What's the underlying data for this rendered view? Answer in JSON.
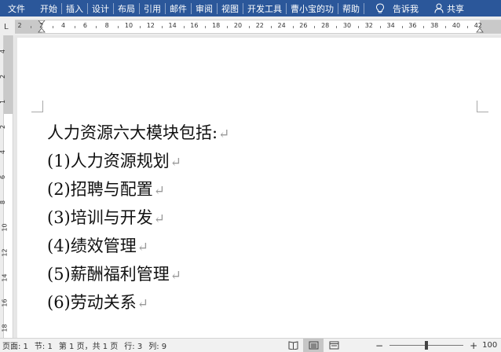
{
  "ribbon": {
    "tabs": [
      "文件",
      "开始",
      "插入",
      "设计",
      "布局",
      "引用",
      "邮件",
      "审阅",
      "视图",
      "开发工具",
      "曹小宝的功",
      "帮助"
    ],
    "tell_me": "告诉我",
    "share": "共享"
  },
  "ruler": {
    "corner_mark": "L",
    "labels": [
      "2",
      "2",
      "4",
      "6",
      "8",
      "10",
      "12",
      "14",
      "16",
      "18",
      "20",
      "22",
      "24",
      "26",
      "28",
      "30",
      "32",
      "34",
      "36",
      "38",
      "40",
      "42"
    ],
    "vertical_labels": [
      "4",
      "2",
      "1",
      "2",
      "4",
      "6",
      "8",
      "10",
      "12",
      "14",
      "16",
      "18"
    ]
  },
  "document": {
    "lines": [
      "人力资源六大模块包括:",
      "(1)人力资源规划",
      "(2)招聘与配置",
      "(3)培训与开发",
      "(4)绩效管理",
      "(5)薪酬福利管理",
      "(6)劳动关系"
    ],
    "paragraph_mark": "↵"
  },
  "status": {
    "page": "页面: 1",
    "section": "节: 1",
    "page_of": "第 1 页，共 1 页",
    "row": "行: 3",
    "col": "列: 9",
    "zoom": "100",
    "zoom_fraction": 0.5
  },
  "colors": {
    "ribbon_bg": "#2b579a",
    "page_bg": "#ffffff",
    "workspace_bg": "#e6e6e6"
  }
}
